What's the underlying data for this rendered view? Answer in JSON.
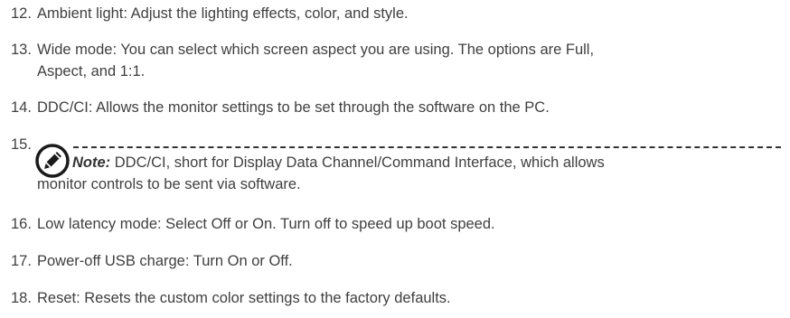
{
  "items": [
    {
      "number": "12.",
      "text": "Ambient light: Adjust the lighting effects, color, and style."
    },
    {
      "number": "13.",
      "line1": "Wide mode: You can select which screen aspect you are using. The options are Full,",
      "line2": "Aspect, and 1:1."
    },
    {
      "number": "14.",
      "text": "DDC/CI: Allows the monitor settings to be set through the software on the PC."
    },
    {
      "number": "15.",
      "note_label": "Note:",
      "note_line1": " DDC/CI, short for Display Data Channel/Command Interface, which allows",
      "note_line2": "monitor controls to be sent via software."
    },
    {
      "number": "16.",
      "text": "Low latency mode: Select Off or On. Turn off to speed up boot speed."
    },
    {
      "number": "17.",
      "text": "Power-off USB charge: Turn On or Off."
    },
    {
      "number": "18.",
      "text": "Reset: Resets the custom color settings to the factory defaults."
    }
  ],
  "note_icon": "pencil-note-icon",
  "colors": {
    "text": "#404040",
    "icon": "#1a1a1a"
  }
}
